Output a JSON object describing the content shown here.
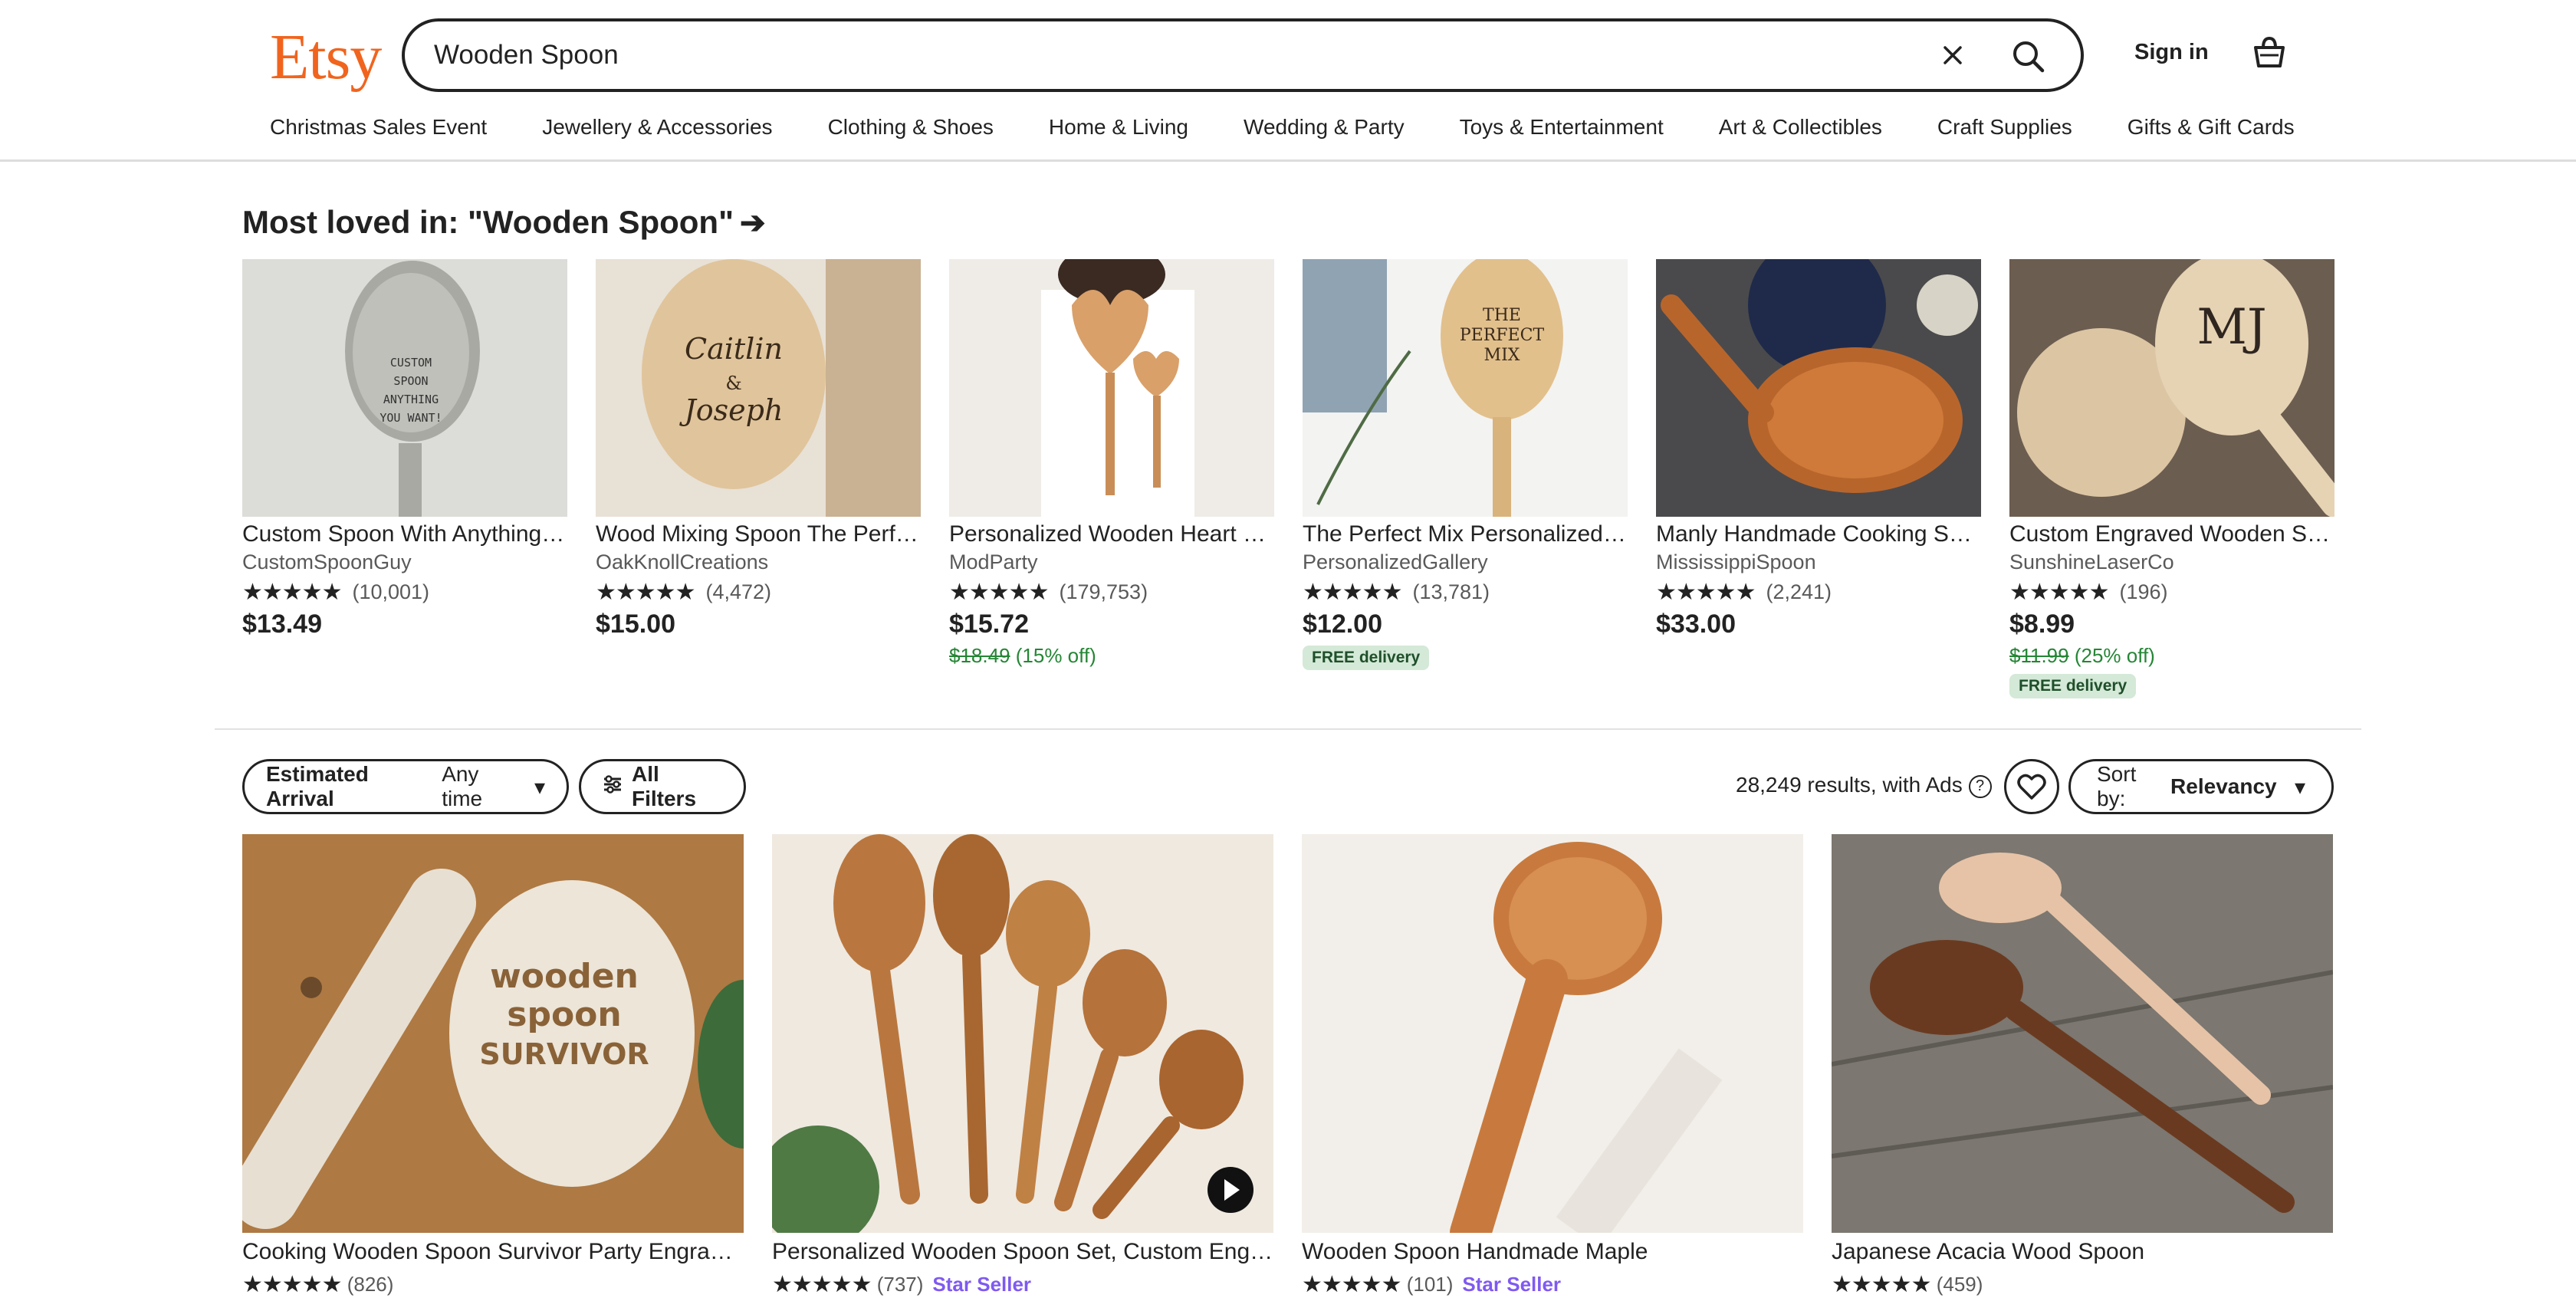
{
  "header": {
    "logo": "Etsy",
    "search_value": "Wooden Spoon",
    "signin_label": "Sign in"
  },
  "nav": [
    "Christmas Sales Event",
    "Jewellery & Accessories",
    "Clothing & Shoes",
    "Home & Living",
    "Wedding & Party",
    "Toys & Entertainment",
    "Art & Collectibles",
    "Craft Supplies",
    "Gifts & Gift Cards"
  ],
  "loved": {
    "title": "Most loved in: \"Wooden Spoon\"",
    "items": [
      {
        "title": "Custom Spoon With Anything You Want",
        "shop": "CustomSpoonGuy",
        "stars": "★★★★★",
        "count": "(10,001)",
        "price": "$13.49",
        "orig": "",
        "discount": "",
        "badge": ""
      },
      {
        "title": "Wood Mixing Spoon The Perfect Mix",
        "shop": "OakKnollCreations",
        "stars": "★★★★★",
        "count": "(4,472)",
        "price": "$15.00",
        "orig": "",
        "discount": "",
        "badge": ""
      },
      {
        "title": "Personalized Wooden Heart Spoon Set",
        "shop": "ModParty",
        "stars": "★★★★★",
        "count": "(179,753)",
        "price": "$15.72",
        "orig": "$18.49",
        "discount": "(15% off)",
        "badge": ""
      },
      {
        "title": "The Perfect Mix Personalized Spoon",
        "shop": "PersonalizedGallery",
        "stars": "★★★★★",
        "count": "(13,781)",
        "price": "$12.00",
        "orig": "",
        "discount": "",
        "badge": "FREE delivery"
      },
      {
        "title": "Manly Handmade Cooking Spoon",
        "shop": "MississippiSpoon",
        "stars": "★★★★★",
        "count": "(2,241)",
        "price": "$33.00",
        "orig": "",
        "discount": "",
        "badge": ""
      },
      {
        "title": "Custom Engraved Wooden Stirring Spoon",
        "shop": "SunshineLaserCo",
        "stars": "★★★★★",
        "count": "(196)",
        "price": "$8.99",
        "orig": "$11.99",
        "discount": "(25% off)",
        "badge": "FREE delivery"
      }
    ]
  },
  "filters": {
    "arrival_label": "Estimated Arrival",
    "arrival_value": "Any time",
    "all_filters": "All Filters",
    "results": "28,249 results,",
    "with_ads": "with Ads",
    "sort_label": "Sort by:",
    "sort_value": "Relevancy"
  },
  "grid": [
    {
      "title": "Cooking Wooden Spoon Survivor Party Engraved",
      "count": "(826)",
      "star_seller": ""
    },
    {
      "title": "Personalized Wooden Spoon Set, Custom Engraved",
      "count": "(737)",
      "star_seller": "Star Seller"
    },
    {
      "title": "Wooden Spoon Handmade Maple",
      "count": "(101)",
      "star_seller": "Star Seller"
    },
    {
      "title": "Japanese Acacia Wood Spoon",
      "count": "(459)",
      "star_seller": ""
    }
  ],
  "colors": {
    "brand": "#f1641e",
    "sale": "#258635",
    "badge_bg": "#d4e9d7",
    "star_seller": "#7f5af0"
  }
}
